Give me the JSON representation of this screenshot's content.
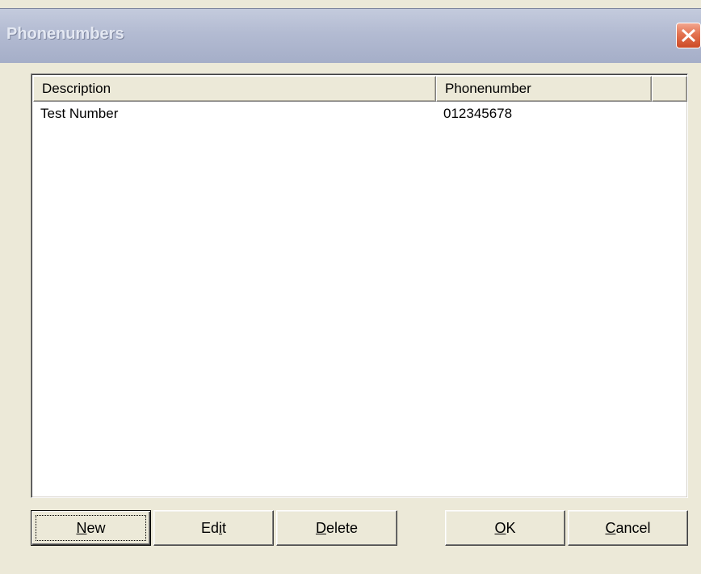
{
  "window": {
    "title": "Phonenumbers",
    "close_icon": "close-icon"
  },
  "colors": {
    "dialog_background": "#ece9d8",
    "titlebar_inactive": "#b3bbd2",
    "close_button": "#e37250",
    "list_background": "#ffffff"
  },
  "list": {
    "columns": [
      {
        "label": "Description"
      },
      {
        "label": "Phonenumber"
      },
      {
        "label": ""
      }
    ],
    "rows": [
      {
        "description": "Test Number",
        "phonenumber": "012345678"
      }
    ]
  },
  "buttons": {
    "new_label": "New",
    "edit_label": "Edit",
    "delete_label": "Delete",
    "ok_label": "OK",
    "cancel_label": "Cancel"
  }
}
